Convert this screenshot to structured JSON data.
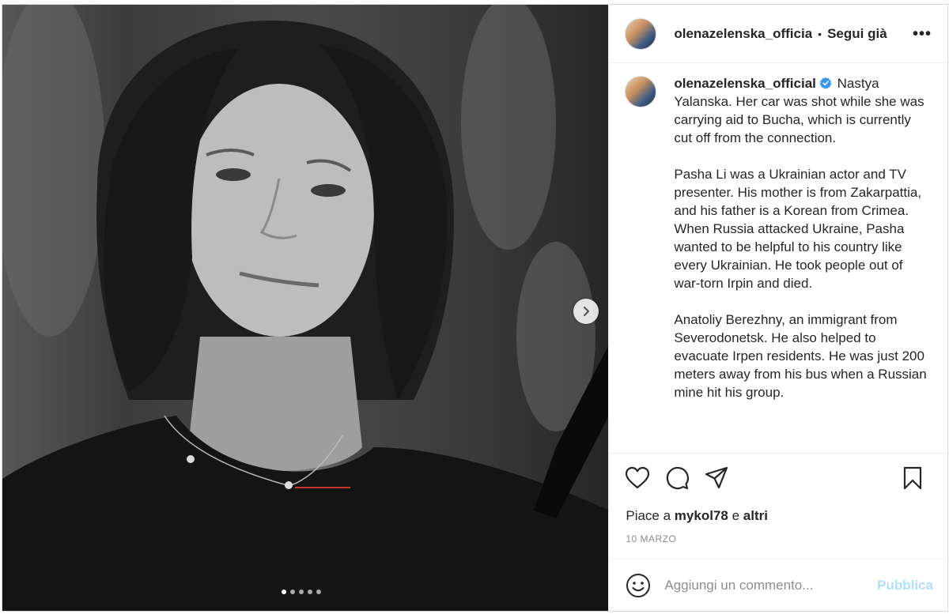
{
  "post": {
    "author": "olenazelenska_official",
    "header_username": "olenazelenska_officia",
    "separator": "•",
    "follow_label": "Segui già",
    "more_label": "•••",
    "caption": {
      "paragraphs": [
        "Nastya Yalanska. Her car was shot while she was carrying aid to Bucha, which is currently cut off from the connection.",
        "Pasha Li was a Ukrainian actor and TV presenter. His mother is from Zakarpattia, and his father is a Korean from Crimea. When Russia attacked Ukraine, Pasha wanted to be helpful to his country like every Ukrainian. He took people out of war-torn Irpin and died.",
        "Anatoliy Berezhny, an immigrant from Severodonetsk. He also helped to evacuate Irpen residents. He was just 200 meters away from his bus when a Russian mine hit his group."
      ]
    },
    "likes": {
      "prefix": "Piace a",
      "user": "mykol78",
      "conjunction": "e",
      "others": "altri"
    },
    "date": "10 MARZO",
    "carousel": {
      "count": 5,
      "active_index": 0
    }
  },
  "comment": {
    "placeholder": "Aggiungi un commento...",
    "publish_label": "Pubblica"
  },
  "icons": {
    "verified": "verified-badge-icon",
    "like": "heart-icon",
    "comment": "comment-bubble-icon",
    "share": "paper-plane-icon",
    "save": "bookmark-icon",
    "emoji": "smiley-icon",
    "next": "chevron-right-icon"
  },
  "colors": {
    "verified_blue": "#3897f0",
    "publish_disabled": "#b2dffc",
    "text": "#262626",
    "muted": "#8e8e8e",
    "border": "#dbdbdb"
  }
}
